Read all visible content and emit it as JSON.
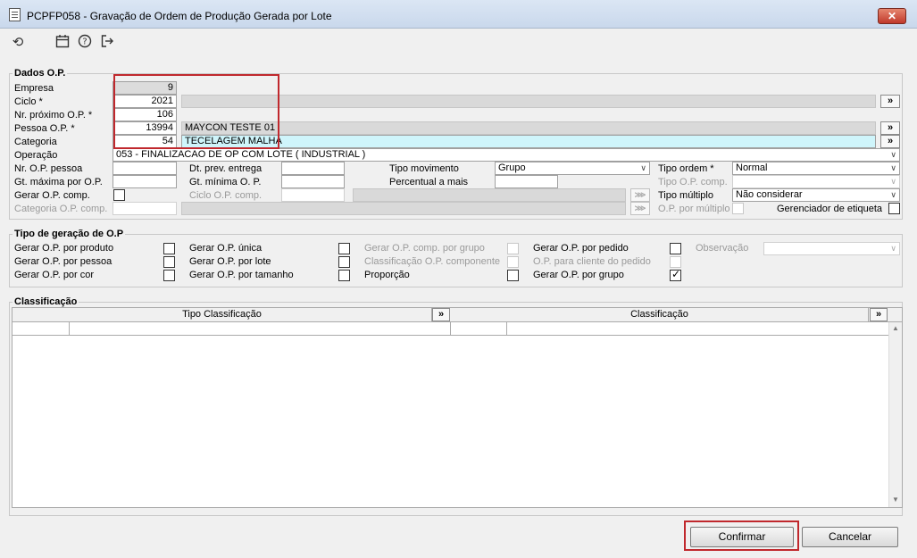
{
  "window": {
    "title": "PCPFP058 - Gravação de Ordem de Produção Gerada por Lote",
    "close_label": "✕"
  },
  "toolbar": {
    "icons": [
      "refresh-icon",
      "calendar-icon",
      "help-icon",
      "exit-icon"
    ]
  },
  "dados": {
    "title": "Dados O.P.",
    "empresa_label": "Empresa",
    "empresa_value": "9",
    "ciclo_label": "Ciclo *",
    "ciclo_value": "2021",
    "nr_proximo_label": "Nr. próximo O.P. *",
    "nr_proximo_value": "106",
    "pessoa_label": "Pessoa O.P. *",
    "pessoa_code": "13994",
    "pessoa_name": "MAYCON TESTE 01",
    "categoria_label": "Categoria",
    "categoria_code": "54",
    "categoria_name": "TECELAGEM MALHA",
    "operacao_label": "Operação",
    "operacao_value": "053 - FINALIZACAO DE OP COM LOTE ( INDUSTRIAL )",
    "nr_op_pessoa_label": "Nr. O.P. pessoa",
    "gt_maxima_label": "Gt. máxima por O.P.",
    "gerar_op_comp_label": "Gerar O.P. comp.",
    "categoria_op_comp_label": "Categoria O.P. comp.",
    "dt_prev_label": "Dt. prev. entrega",
    "gt_minima_label": "Gt. mínima O. P.",
    "ciclo_op_comp_label": "Ciclo O.P. comp.",
    "tipo_mov_label": "Tipo movimento",
    "tipo_mov_value": "Grupo",
    "percentual_label": "Percentual a mais",
    "tipo_ordem_label": "Tipo ordem *",
    "tipo_ordem_value": "Normal",
    "tipo_op_comp_label": "Tipo O.P. comp.",
    "tipo_multiplo_label": "Tipo múltiplo",
    "tipo_multiplo_value": "Não considerar",
    "op_por_multiplo_label": "O.P. por múltiplo",
    "gerenciador_label": "Gerenciador de etiqueta",
    "more_label": "»"
  },
  "geracao": {
    "title": "Tipo de geração de O.P",
    "col1": [
      "Gerar O.P. por produto",
      "Gerar O.P. por pessoa",
      "Gerar O.P. por cor"
    ],
    "col2": [
      "Gerar O.P. única",
      "Gerar O.P. por lote",
      "Gerar O.P. por tamanho"
    ],
    "col3": [
      "Gerar O.P. comp. por grupo",
      "Classificação O.P. componente",
      "Proporção"
    ],
    "col4": [
      "Gerar O.P. por pedido",
      "O.P. para cliente do pedido",
      "Gerar O.P. por grupo"
    ],
    "observacao_label": "Observação",
    "checked_item": "Gerar O.P. por grupo"
  },
  "classificacao": {
    "title": "Classificação",
    "col_tipo": "Tipo Classificação",
    "col_class": "Classificação",
    "more_label": "»"
  },
  "buttons": {
    "confirmar": "Confirmar",
    "cancelar": "Cancelar"
  },
  "colors": {
    "highlight_red": "#c0282d",
    "cyan_field": "#cff5fb"
  }
}
